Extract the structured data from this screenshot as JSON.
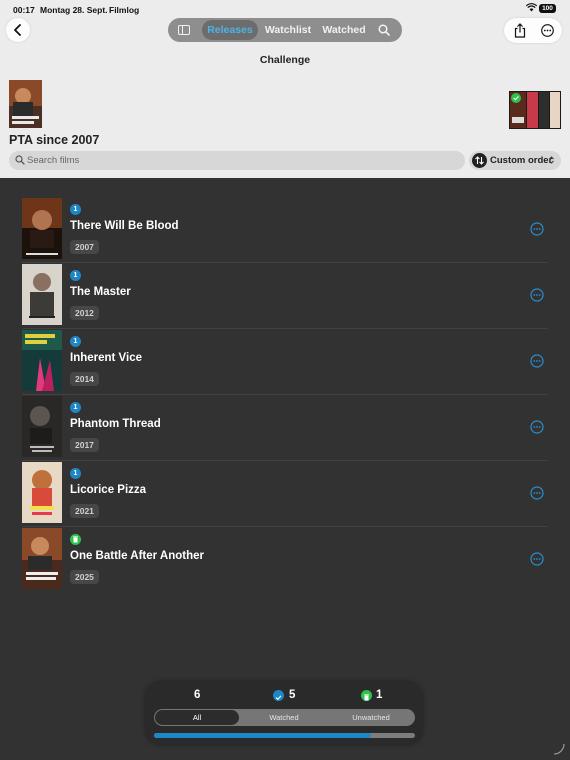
{
  "status_bar": {
    "time": "00:17",
    "date": "Montag 28. Sept.",
    "app": "Filmlog",
    "battery": "100"
  },
  "nav": {
    "tabs": [
      {
        "label": "Releases",
        "active": true
      },
      {
        "label": "Watchlist",
        "active": false
      },
      {
        "label": "Watched",
        "active": false
      }
    ],
    "accent_color": "#4cb4ea"
  },
  "section_label": "Challenge",
  "list": {
    "title": "PTA since 2007"
  },
  "search": {
    "placeholder": "Search films"
  },
  "order": {
    "label": "Custom order"
  },
  "films": [
    {
      "title": "There Will Be Blood",
      "year": "2007",
      "badge": "1",
      "status": "blue"
    },
    {
      "title": "The Master",
      "year": "2012",
      "badge": "1",
      "status": "blue"
    },
    {
      "title": "Inherent Vice",
      "year": "2014",
      "badge": "1",
      "status": "blue"
    },
    {
      "title": "Phantom Thread",
      "year": "2017",
      "badge": "1",
      "status": "blue"
    },
    {
      "title": "Licorice Pizza",
      "year": "2021",
      "badge": "1",
      "status": "blue"
    },
    {
      "title": "One Battle After Another",
      "year": "2025",
      "badge": "",
      "status": "green"
    }
  ],
  "stats": {
    "all_count": "6",
    "watched_count": "5",
    "unwatched_count": "1",
    "filters": [
      "All",
      "Watched",
      "Unwatched"
    ],
    "active_filter": "All",
    "watched_progress": 0.833,
    "watched_color": "#1c88c8",
    "unwatched_color": "#2fc24b"
  }
}
